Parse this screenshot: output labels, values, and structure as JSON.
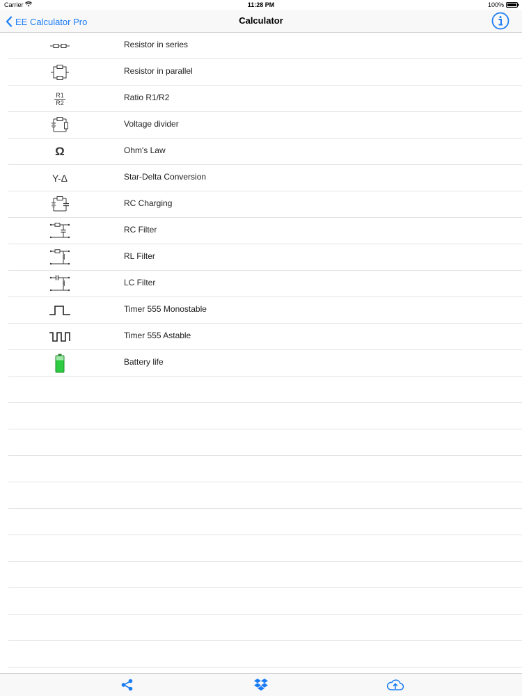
{
  "status_bar": {
    "carrier": "Carrier",
    "time": "11:28 PM",
    "battery": "100%"
  },
  "nav": {
    "back_label": "EE Calculator Pro",
    "title": "Calculator"
  },
  "items": [
    {
      "label": "Resistor in series",
      "icon": "resistor-series-icon"
    },
    {
      "label": "Resistor in parallel",
      "icon": "resistor-parallel-icon"
    },
    {
      "label": "Ratio R1/R2",
      "icon": "ratio-icon",
      "icon_text": [
        "R1",
        "R2"
      ]
    },
    {
      "label": "Voltage divider",
      "icon": "voltage-divider-icon"
    },
    {
      "label": "Ohm's Law",
      "icon": "omega-icon",
      "icon_text": "Ω"
    },
    {
      "label": "Star-Delta Conversion",
      "icon": "star-delta-icon",
      "icon_text": "Y-Δ"
    },
    {
      "label": "RC Charging",
      "icon": "rc-charging-icon"
    },
    {
      "label": "RC Filter",
      "icon": "rc-filter-icon"
    },
    {
      "label": "RL Filter",
      "icon": "rl-filter-icon"
    },
    {
      "label": "LC Filter",
      "icon": "lc-filter-icon"
    },
    {
      "label": "Timer 555 Monostable",
      "icon": "monostable-pulse-icon"
    },
    {
      "label": "Timer 555 Astable",
      "icon": "astable-pulse-icon"
    },
    {
      "label": "Battery life",
      "icon": "battery-icon"
    }
  ],
  "tab_bar": {
    "share_icon": "share-icon",
    "dropbox_icon": "dropbox-icon",
    "cloud_icon": "cloud-upload-icon"
  },
  "colors": {
    "accent": "#1a7cf5",
    "battery_green": "#2ecc40",
    "separator": "#e3e3e6"
  }
}
